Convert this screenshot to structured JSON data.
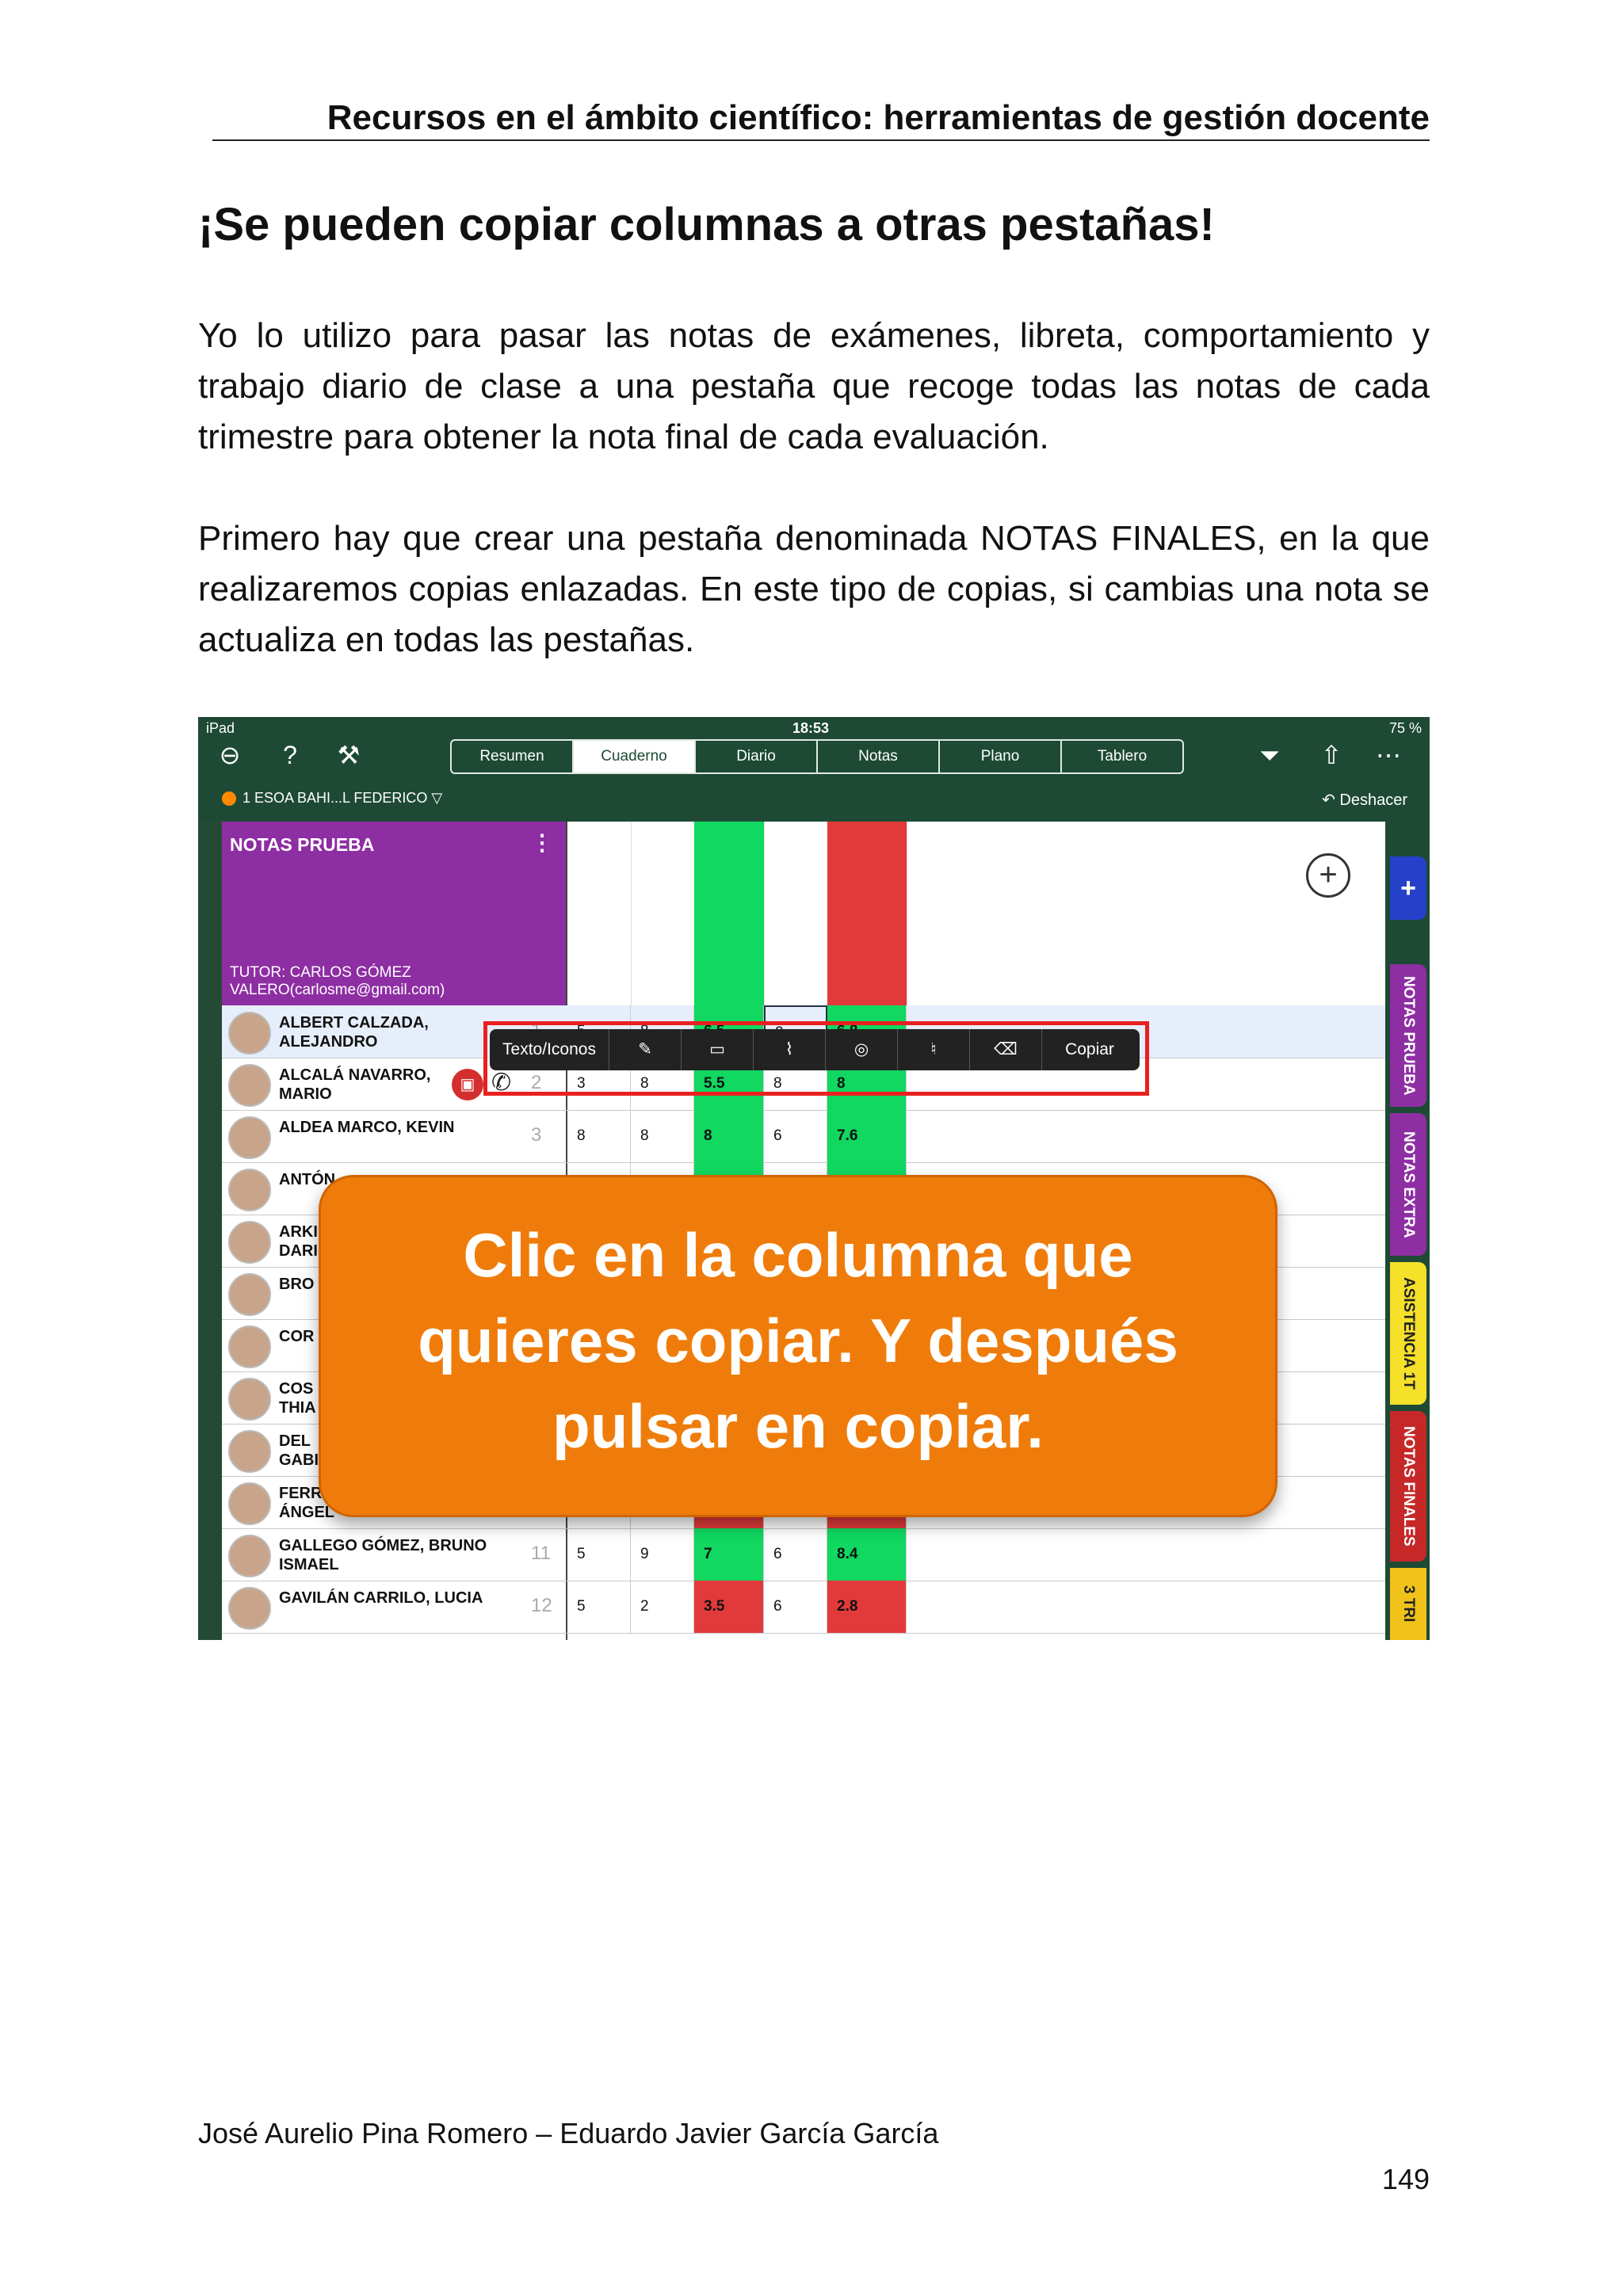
{
  "header": "Recursos en el ámbito científico: herramientas de gestión docente",
  "title": "¡Se pueden copiar columnas a otras pestañas!",
  "paragraph1": "Yo lo utilizo para pasar las notas de exámenes, libreta, comportamiento y trabajo diario de clase a una pestaña que recoge todas las notas de cada trimestre para obtener la nota final de cada evaluación.",
  "paragraph2": "Primero hay que crear una pestaña denominada NOTAS FINALES, en la que realizaremos copias enlazadas. En este tipo de copias, si cambias una nota se actualiza en todas las pestañas.",
  "footer": "José Aurelio Pina Romero – Eduardo Javier García García",
  "page_number": "149",
  "screenshot": {
    "status_left": "iPad",
    "time": "18:53",
    "battery": "75 %",
    "nav_tabs": [
      "Resumen",
      "Cuaderno",
      "Diario",
      "Notas",
      "Plano",
      "Tablero"
    ],
    "active_tab": "Cuaderno",
    "course": "1 ESOA  BAHI...L FEDERICO ▽",
    "undo": "Deshacer",
    "sheet_title": "NOTAS PRUEBA",
    "tutor_line1": "TUTOR: CARLOS GÓMEZ",
    "tutor_line2": "VALERO(carlosme@gmail.com)",
    "popup": [
      "Texto/Iconos",
      "Copiar"
    ],
    "students": [
      {
        "name1": "ALBERT CALZADA,",
        "name2": "ALEJANDRO",
        "num": "1",
        "grades": [
          "5",
          "8",
          "6.5",
          "2",
          "6.8"
        ]
      },
      {
        "name1": "ALCALÁ NAVARRO,",
        "name2": "MARIO",
        "num": "2",
        "grades": [
          "3",
          "8",
          "5.5",
          "8",
          "8"
        ]
      },
      {
        "name1": "ALDEA MARCO, KEVIN",
        "name2": "",
        "num": "3",
        "grades": [
          "8",
          "8",
          "8",
          "6",
          "7.6"
        ]
      },
      {
        "name1": "ANTÓN",
        "name2": "",
        "num": "",
        "grades": [
          "",
          "",
          "",
          "",
          ""
        ]
      },
      {
        "name1": "ARKI",
        "name2": "DARI",
        "num": "",
        "grades": [
          "",
          "",
          "",
          "",
          ""
        ]
      },
      {
        "name1": "BRO",
        "name2": "",
        "num": "",
        "grades": [
          "",
          "",
          "",
          "",
          ""
        ]
      },
      {
        "name1": "COR",
        "name2": "",
        "num": "",
        "grades": [
          "",
          "",
          "",
          "",
          ""
        ]
      },
      {
        "name1": "COS",
        "name2": "THIA",
        "num": "",
        "grades": [
          "",
          "",
          "",
          "",
          ""
        ]
      },
      {
        "name1": "DEL",
        "name2": "GABI",
        "num": "",
        "grades": [
          "",
          "",
          "",
          "",
          ""
        ]
      },
      {
        "name1": "FERR",
        "name2": "ÁNGEL",
        "num": "",
        "grades": [
          "",
          "",
          "",
          "",
          ""
        ]
      },
      {
        "name1": "GALLEGO GÓMEZ, BRUNO",
        "name2": "ISMAEL",
        "num": "11",
        "grades": [
          "5",
          "9",
          "7",
          "6",
          "8.4"
        ]
      },
      {
        "name1": "GAVILÁN CARRILO, LUCIA",
        "name2": "",
        "num": "12",
        "grades": [
          "5",
          "2",
          "3.5",
          "6",
          "2.8"
        ]
      }
    ],
    "side_tabs": [
      "NOTAS PRUEBA",
      "NOTAS EXTRA",
      "ASISTENCIA 1T",
      "NOTAS FINALES",
      "3 TRI"
    ],
    "callout": [
      "Clic en la columna que",
      "quieres copiar. Y después",
      "pulsar en copiar."
    ]
  }
}
